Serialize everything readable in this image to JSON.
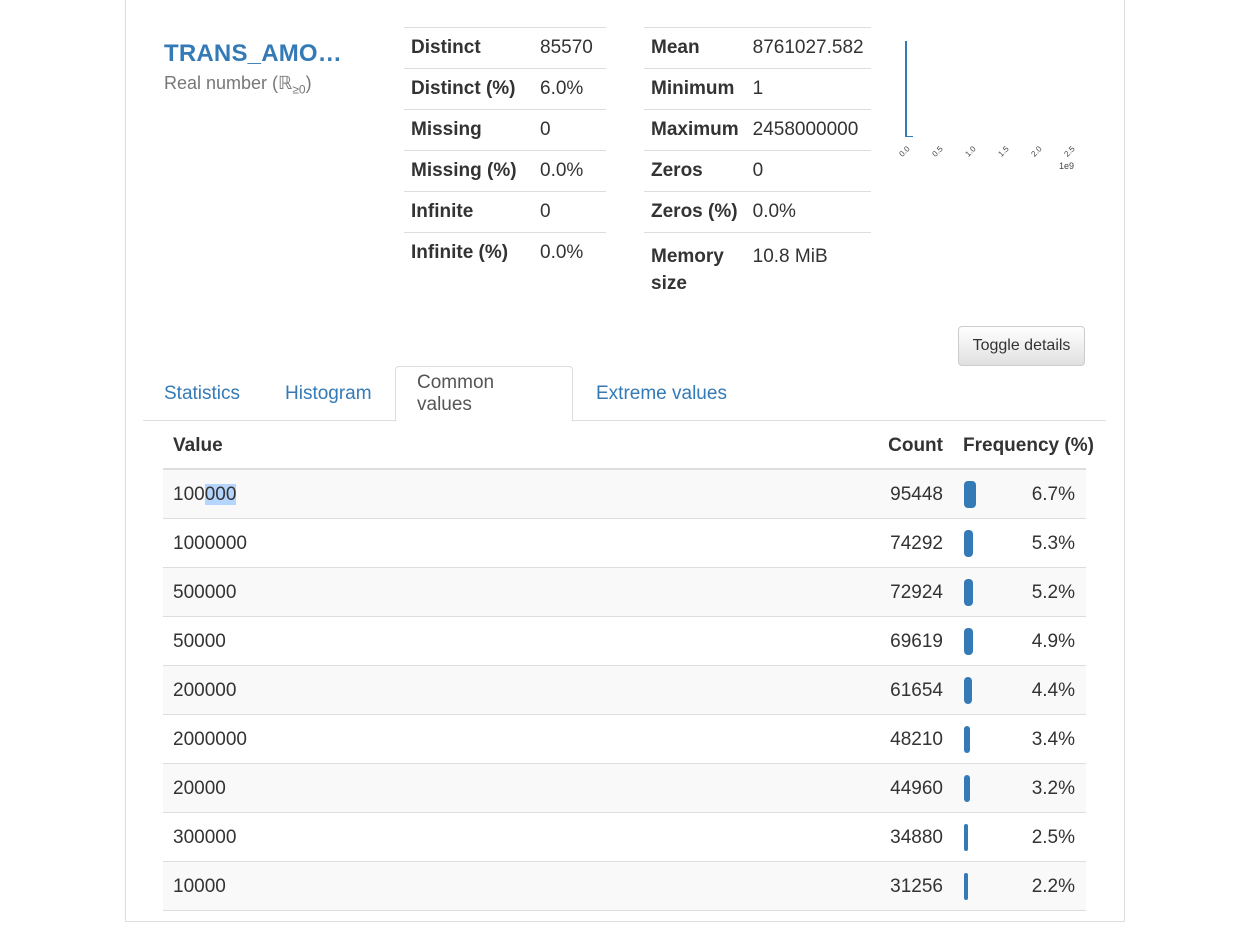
{
  "variable": {
    "name": "TRANS_AMO…",
    "type_prefix": "Real number (ℝ",
    "type_sub": "≥0",
    "type_suffix": ")"
  },
  "stats_left": [
    {
      "label": "Distinct",
      "value": "85570"
    },
    {
      "label": "Distinct (%)",
      "value": "6.0%"
    },
    {
      "label": "Missing",
      "value": "0"
    },
    {
      "label": "Missing (%)",
      "value": "0.0%"
    },
    {
      "label": "Infinite",
      "value": "0"
    },
    {
      "label": "Infinite (%)",
      "value": "0.0%"
    }
  ],
  "stats_right": [
    {
      "label": "Mean",
      "value": "8761027.582"
    },
    {
      "label": "Minimum",
      "value": "1"
    },
    {
      "label": "Maximum",
      "value": "2458000000"
    },
    {
      "label": "Zeros",
      "value": "0"
    },
    {
      "label": "Zeros (%)",
      "value": "0.0%"
    },
    {
      "label": "Memory size",
      "value": "10.8 MiB"
    }
  ],
  "mini_histogram": {
    "x_ticks": [
      "0.0",
      "0.5",
      "1.0",
      "1.5",
      "2.0",
      "2.5"
    ],
    "x_exponent": "1e9",
    "bar_color": "#337ab7"
  },
  "toggle_button": "Toggle details",
  "tabs": [
    {
      "label": "Statistics",
      "active": false
    },
    {
      "label": "Histogram",
      "active": false
    },
    {
      "label": "Common values",
      "active": true
    },
    {
      "label": "Extreme values",
      "active": false
    }
  ],
  "common_values": {
    "headers": {
      "value": "Value",
      "count": "Count",
      "frequency": "Frequency (%)"
    },
    "rows": [
      {
        "value": "100000",
        "count": "95448",
        "pct": "6.7%",
        "freq": 0.067
      },
      {
        "value": "1000000",
        "count": "74292",
        "pct": "5.3%",
        "freq": 0.053
      },
      {
        "value": "500000",
        "count": "72924",
        "pct": "5.2%",
        "freq": 0.052
      },
      {
        "value": "50000",
        "count": "69619",
        "pct": "4.9%",
        "freq": 0.049
      },
      {
        "value": "200000",
        "count": "61654",
        "pct": "4.4%",
        "freq": 0.044
      },
      {
        "value": "2000000",
        "count": "48210",
        "pct": "3.4%",
        "freq": 0.034
      },
      {
        "value": "20000",
        "count": "44960",
        "pct": "3.2%",
        "freq": 0.032
      },
      {
        "value": "300000",
        "count": "34880",
        "pct": "2.5%",
        "freq": 0.025
      },
      {
        "value": "10000",
        "count": "31256",
        "pct": "2.2%",
        "freq": 0.022
      }
    ]
  },
  "colors": {
    "accent": "#337ab7",
    "selection": "#b4d5fe"
  }
}
